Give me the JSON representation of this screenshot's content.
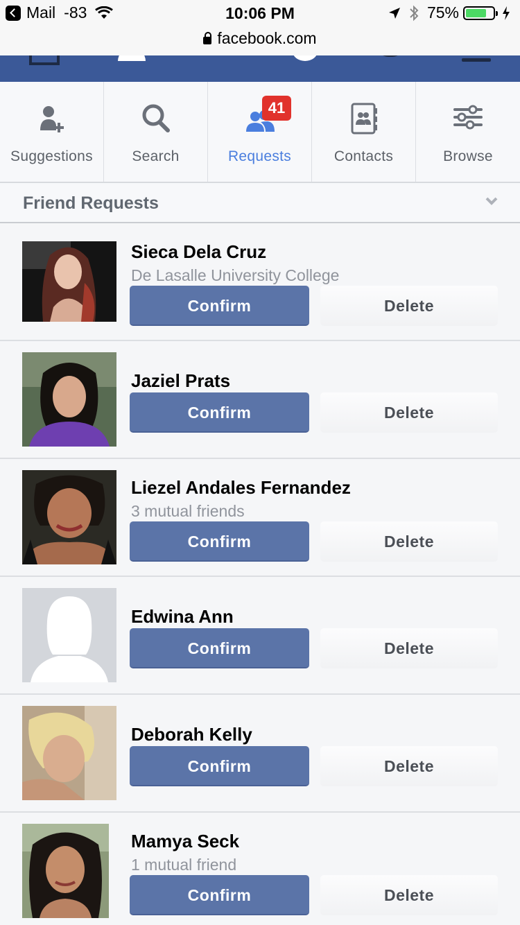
{
  "status_bar": {
    "back_app": "Mail",
    "signal": "-83",
    "time": "10:06 PM",
    "battery_percent": "75%",
    "battery_level": 0.75,
    "battery_color": "#4cd964"
  },
  "url_bar": {
    "domain": "facebook.com",
    "icon": "lock-icon"
  },
  "nav_bar": {
    "color": "#3b5998",
    "icons": [
      "home-icon",
      "friends-icon",
      "messages-icon",
      "globe-icon",
      "search-icon",
      "menu-icon"
    ]
  },
  "tabs": [
    {
      "label": "Suggestions",
      "icon": "add-person-icon"
    },
    {
      "label": "Search",
      "icon": "search-icon"
    },
    {
      "label": "Requests",
      "icon": "friends-icon",
      "active": true,
      "badge": "41"
    },
    {
      "label": "Contacts",
      "icon": "contacts-book-icon"
    },
    {
      "label": "Browse",
      "icon": "sliders-icon"
    }
  ],
  "accent_color": "#4a7ede",
  "section": {
    "title": "Friend Requests"
  },
  "requests": [
    {
      "name": "Sieca Dela Cruz",
      "subtitle": "De Lasalle University College",
      "confirm_label": "Confirm",
      "delete_label": "Delete"
    },
    {
      "name": "Jaziel Prats",
      "subtitle": "",
      "confirm_label": "Confirm",
      "delete_label": "Delete"
    },
    {
      "name": "Liezel Andales Fernandez",
      "subtitle": "3 mutual friends",
      "confirm_label": "Confirm",
      "delete_label": "Delete"
    },
    {
      "name": "Edwina Ann",
      "subtitle": "",
      "confirm_label": "Confirm",
      "delete_label": "Delete"
    },
    {
      "name": "Deborah Kelly",
      "subtitle": "",
      "confirm_label": "Confirm",
      "delete_label": "Delete"
    },
    {
      "name": "Mamya Seck",
      "subtitle": "1 mutual friend",
      "confirm_label": "Confirm",
      "delete_label": "Delete"
    }
  ],
  "button_colors": {
    "confirm": "#5b74a8",
    "delete": "#f1f2f4"
  }
}
